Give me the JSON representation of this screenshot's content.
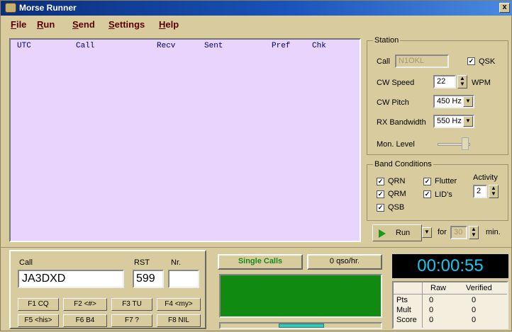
{
  "window": {
    "title": "Morse Runner",
    "close_glyph": "x"
  },
  "menu": [
    "File",
    "Run",
    "Send",
    "Settings",
    "Help"
  ],
  "log": {
    "columns": [
      "UTC",
      "Call",
      "Recv",
      "Sent",
      "Pref",
      "Chk"
    ]
  },
  "station": {
    "group_title": "Station",
    "call_label": "Call",
    "call_value": "N1OKL",
    "qsk_label": "QSK",
    "qsk_checked": true,
    "cw_speed_label": "CW Speed",
    "cw_speed_value": "22",
    "cw_speed_unit": "WPM",
    "cw_pitch_label": "CW Pitch",
    "cw_pitch_value": "450 Hz",
    "rx_bw_label": "RX Bandwidth",
    "rx_bw_value": "550 Hz",
    "mon_level_label": "Mon. Level",
    "mon_level_fraction": 0.85
  },
  "band_conditions": {
    "group_title": "Band Conditions",
    "qrn": "QRN",
    "qrm": "QRM",
    "qsb": "QSB",
    "flutter": "Flutter",
    "lids": "LID's",
    "activity_label": "Activity",
    "activity_value": "2"
  },
  "run": {
    "button_label": "Run",
    "for_label": "for",
    "minutes_value": "30",
    "min_label": "min."
  },
  "entry": {
    "call_label": "Call",
    "call_value": "JA3DXD",
    "rst_label": "RST",
    "rst_value": "599",
    "nr_label": "Nr.",
    "nr_value": ""
  },
  "fkeys": {
    "f1": "F1  CQ",
    "f2": "F2  <#>",
    "f3": "F3  TU",
    "f4": "F4  <my>",
    "f5": "F5  <his>",
    "f6": "F6  B4",
    "f7": "F7  ?",
    "f8": "F8  NIL"
  },
  "status": {
    "mode": "Single Calls",
    "rate": "0 qso/hr."
  },
  "clock": {
    "time": "00:00:55"
  },
  "score": {
    "col_raw": "Raw",
    "col_verified": "Verified",
    "rows": [
      {
        "label": "Pts",
        "raw": "0",
        "verified": "0"
      },
      {
        "label": "Mult",
        "raw": "0",
        "verified": "0"
      },
      {
        "label": "Score",
        "raw": "0",
        "verified": "0"
      }
    ]
  },
  "colors": {
    "log_bg": "#e8d4fc",
    "scope_green": "#118a11",
    "clock_fg": "#17c8ee"
  }
}
